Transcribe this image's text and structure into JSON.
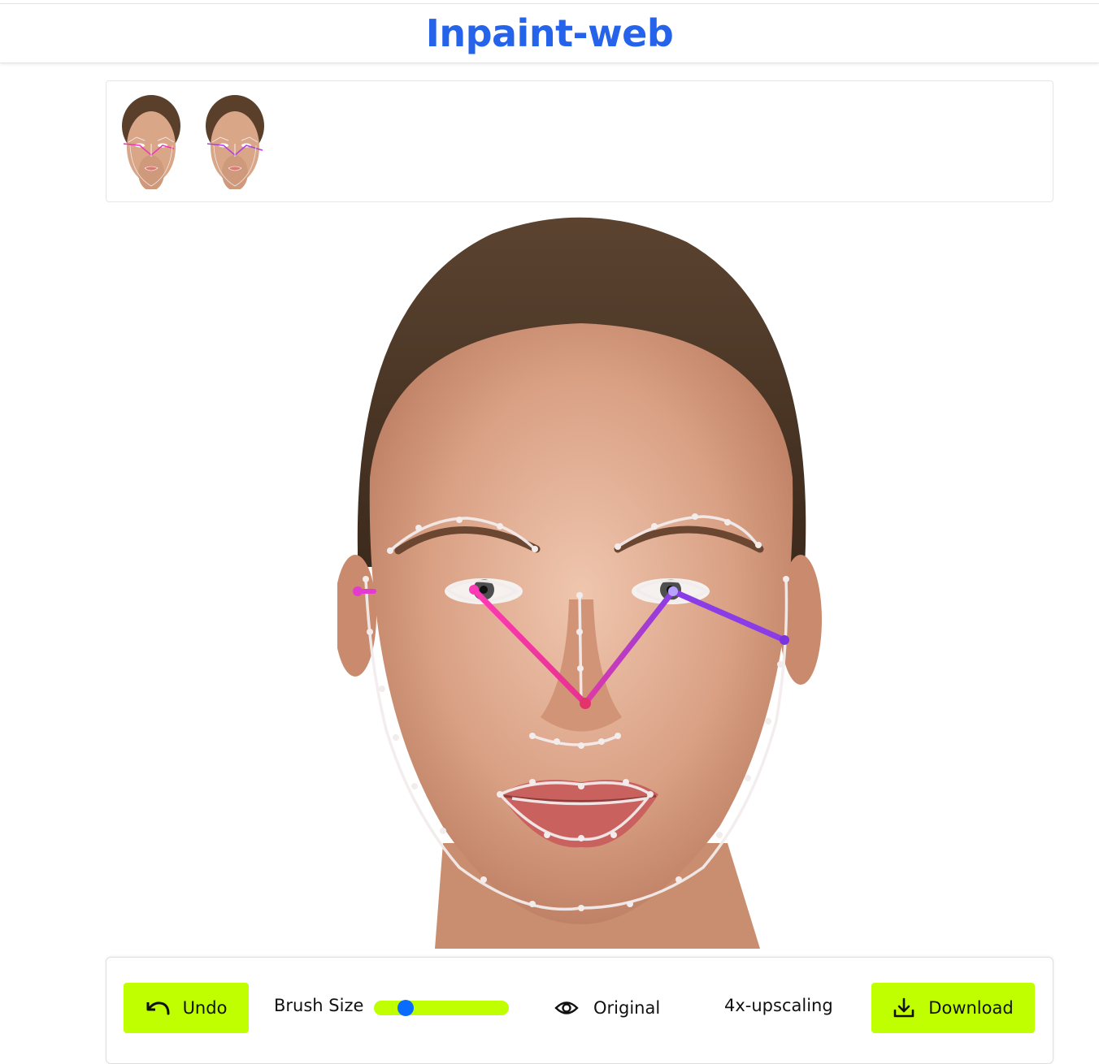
{
  "app": {
    "title": "Inpaint-web",
    "title_color": "#2563eb"
  },
  "thumbnails": [
    {
      "name": "thumbnail-1"
    },
    {
      "name": "thumbnail-2"
    }
  ],
  "toolbar": {
    "undo_label": "Undo",
    "undo_icon": "undo-arrow-icon",
    "brush_size_label": "Brush Size",
    "brush_size_value": 0.2,
    "original_label": "Original",
    "original_icon": "eye-icon",
    "upscale_label": "4x-upscaling",
    "download_label": "Download",
    "download_icon": "download-icon",
    "accent_color": "#bfff00",
    "slider_thumb_color": "#0a6cff"
  }
}
